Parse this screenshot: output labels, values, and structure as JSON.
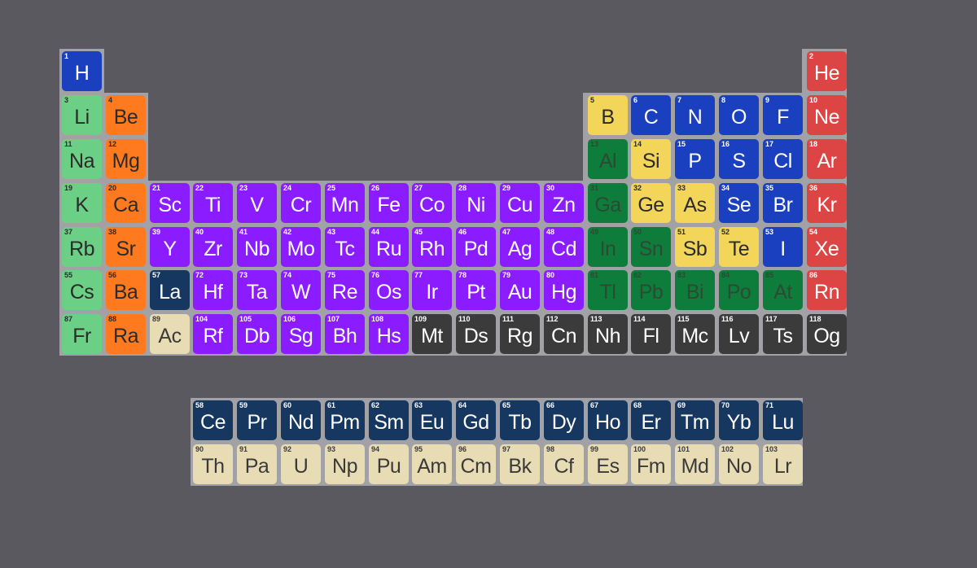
{
  "colors": {
    "background": "#5a595f",
    "panel": "#a2a2a6",
    "categories": {
      "nonmetal": {
        "bg": "#1a3fbf",
        "fg": "#ffffff"
      },
      "noble": {
        "bg": "#dd4444",
        "fg": "#ffffff"
      },
      "alkali": {
        "bg": "#6ccf86",
        "fg": "#2b2b2b"
      },
      "alkaline": {
        "bg": "#ff7a1f",
        "fg": "#2b2b2b"
      },
      "metalloid": {
        "bg": "#f3d55a",
        "fg": "#2b2b2b"
      },
      "posttransition": {
        "bg": "#0e7c3a",
        "fg": "#2c4a34"
      },
      "transition": {
        "bg": "#8a1cff",
        "fg": "#ffffff"
      },
      "lanthanide": {
        "bg": "#16375f",
        "fg": "#ffffff"
      },
      "actinide": {
        "bg": "#e8dcb5",
        "fg": "#3a3a3a"
      },
      "unknown": {
        "bg": "#3b3b3b",
        "fg": "#ffffff"
      }
    }
  },
  "elements": [
    {
      "num": "1",
      "sym": "H",
      "cat": "nonmetal",
      "row": 1,
      "col": 1
    },
    {
      "num": "2",
      "sym": "He",
      "cat": "noble",
      "row": 1,
      "col": 18
    },
    {
      "num": "3",
      "sym": "Li",
      "cat": "alkali",
      "row": 2,
      "col": 1
    },
    {
      "num": "4",
      "sym": "Be",
      "cat": "alkaline",
      "row": 2,
      "col": 2
    },
    {
      "num": "5",
      "sym": "B",
      "cat": "metalloid",
      "row": 2,
      "col": 13
    },
    {
      "num": "6",
      "sym": "C",
      "cat": "nonmetal",
      "row": 2,
      "col": 14
    },
    {
      "num": "7",
      "sym": "N",
      "cat": "nonmetal",
      "row": 2,
      "col": 15
    },
    {
      "num": "8",
      "sym": "O",
      "cat": "nonmetal",
      "row": 2,
      "col": 16
    },
    {
      "num": "9",
      "sym": "F",
      "cat": "nonmetal",
      "row": 2,
      "col": 17
    },
    {
      "num": "10",
      "sym": "Ne",
      "cat": "noble",
      "row": 2,
      "col": 18
    },
    {
      "num": "11",
      "sym": "Na",
      "cat": "alkali",
      "row": 3,
      "col": 1
    },
    {
      "num": "12",
      "sym": "Mg",
      "cat": "alkaline",
      "row": 3,
      "col": 2
    },
    {
      "num": "13",
      "sym": "Al",
      "cat": "posttransition",
      "row": 3,
      "col": 13
    },
    {
      "num": "14",
      "sym": "Si",
      "cat": "metalloid",
      "row": 3,
      "col": 14
    },
    {
      "num": "15",
      "sym": "P",
      "cat": "nonmetal",
      "row": 3,
      "col": 15
    },
    {
      "num": "16",
      "sym": "S",
      "cat": "nonmetal",
      "row": 3,
      "col": 16
    },
    {
      "num": "17",
      "sym": "Cl",
      "cat": "nonmetal",
      "row": 3,
      "col": 17
    },
    {
      "num": "18",
      "sym": "Ar",
      "cat": "noble",
      "row": 3,
      "col": 18
    },
    {
      "num": "19",
      "sym": "K",
      "cat": "alkali",
      "row": 4,
      "col": 1
    },
    {
      "num": "20",
      "sym": "Ca",
      "cat": "alkaline",
      "row": 4,
      "col": 2
    },
    {
      "num": "21",
      "sym": "Sc",
      "cat": "transition",
      "row": 4,
      "col": 3
    },
    {
      "num": "22",
      "sym": "Ti",
      "cat": "transition",
      "row": 4,
      "col": 4
    },
    {
      "num": "23",
      "sym": "V",
      "cat": "transition",
      "row": 4,
      "col": 5
    },
    {
      "num": "24",
      "sym": "Cr",
      "cat": "transition",
      "row": 4,
      "col": 6
    },
    {
      "num": "25",
      "sym": "Mn",
      "cat": "transition",
      "row": 4,
      "col": 7
    },
    {
      "num": "26",
      "sym": "Fe",
      "cat": "transition",
      "row": 4,
      "col": 8
    },
    {
      "num": "27",
      "sym": "Co",
      "cat": "transition",
      "row": 4,
      "col": 9
    },
    {
      "num": "28",
      "sym": "Ni",
      "cat": "transition",
      "row": 4,
      "col": 10
    },
    {
      "num": "29",
      "sym": "Cu",
      "cat": "transition",
      "row": 4,
      "col": 11
    },
    {
      "num": "30",
      "sym": "Zn",
      "cat": "transition",
      "row": 4,
      "col": 12
    },
    {
      "num": "31",
      "sym": "Ga",
      "cat": "posttransition",
      "row": 4,
      "col": 13
    },
    {
      "num": "32",
      "sym": "Ge",
      "cat": "metalloid",
      "row": 4,
      "col": 14
    },
    {
      "num": "33",
      "sym": "As",
      "cat": "metalloid",
      "row": 4,
      "col": 15
    },
    {
      "num": "34",
      "sym": "Se",
      "cat": "nonmetal",
      "row": 4,
      "col": 16
    },
    {
      "num": "35",
      "sym": "Br",
      "cat": "nonmetal",
      "row": 4,
      "col": 17
    },
    {
      "num": "36",
      "sym": "Kr",
      "cat": "noble",
      "row": 4,
      "col": 18
    },
    {
      "num": "37",
      "sym": "Rb",
      "cat": "alkali",
      "row": 5,
      "col": 1
    },
    {
      "num": "38",
      "sym": "Sr",
      "cat": "alkaline",
      "row": 5,
      "col": 2
    },
    {
      "num": "39",
      "sym": "Y",
      "cat": "transition",
      "row": 5,
      "col": 3
    },
    {
      "num": "40",
      "sym": "Zr",
      "cat": "transition",
      "row": 5,
      "col": 4
    },
    {
      "num": "41",
      "sym": "Nb",
      "cat": "transition",
      "row": 5,
      "col": 5
    },
    {
      "num": "42",
      "sym": "Mo",
      "cat": "transition",
      "row": 5,
      "col": 6
    },
    {
      "num": "43",
      "sym": "Tc",
      "cat": "transition",
      "row": 5,
      "col": 7
    },
    {
      "num": "44",
      "sym": "Ru",
      "cat": "transition",
      "row": 5,
      "col": 8
    },
    {
      "num": "45",
      "sym": "Rh",
      "cat": "transition",
      "row": 5,
      "col": 9
    },
    {
      "num": "46",
      "sym": "Pd",
      "cat": "transition",
      "row": 5,
      "col": 10
    },
    {
      "num": "47",
      "sym": "Ag",
      "cat": "transition",
      "row": 5,
      "col": 11
    },
    {
      "num": "48",
      "sym": "Cd",
      "cat": "transition",
      "row": 5,
      "col": 12
    },
    {
      "num": "49",
      "sym": "In",
      "cat": "posttransition",
      "row": 5,
      "col": 13
    },
    {
      "num": "50",
      "sym": "Sn",
      "cat": "posttransition",
      "row": 5,
      "col": 14
    },
    {
      "num": "51",
      "sym": "Sb",
      "cat": "metalloid",
      "row": 5,
      "col": 15
    },
    {
      "num": "52",
      "sym": "Te",
      "cat": "metalloid",
      "row": 5,
      "col": 16
    },
    {
      "num": "53",
      "sym": "I",
      "cat": "nonmetal",
      "row": 5,
      "col": 17
    },
    {
      "num": "54",
      "sym": "Xe",
      "cat": "noble",
      "row": 5,
      "col": 18
    },
    {
      "num": "55",
      "sym": "Cs",
      "cat": "alkali",
      "row": 6,
      "col": 1
    },
    {
      "num": "56",
      "sym": "Ba",
      "cat": "alkaline",
      "row": 6,
      "col": 2
    },
    {
      "num": "57",
      "sym": "La",
      "cat": "lanthanide",
      "row": 6,
      "col": 3
    },
    {
      "num": "72",
      "sym": "Hf",
      "cat": "transition",
      "row": 6,
      "col": 4
    },
    {
      "num": "73",
      "sym": "Ta",
      "cat": "transition",
      "row": 6,
      "col": 5
    },
    {
      "num": "74",
      "sym": "W",
      "cat": "transition",
      "row": 6,
      "col": 6
    },
    {
      "num": "75",
      "sym": "Re",
      "cat": "transition",
      "row": 6,
      "col": 7
    },
    {
      "num": "76",
      "sym": "Os",
      "cat": "transition",
      "row": 6,
      "col": 8
    },
    {
      "num": "77",
      "sym": "Ir",
      "cat": "transition",
      "row": 6,
      "col": 9
    },
    {
      "num": "78",
      "sym": "Pt",
      "cat": "transition",
      "row": 6,
      "col": 10
    },
    {
      "num": "79",
      "sym": "Au",
      "cat": "transition",
      "row": 6,
      "col": 11
    },
    {
      "num": "80",
      "sym": "Hg",
      "cat": "transition",
      "row": 6,
      "col": 12
    },
    {
      "num": "81",
      "sym": "Tl",
      "cat": "posttransition",
      "row": 6,
      "col": 13
    },
    {
      "num": "82",
      "sym": "Pb",
      "cat": "posttransition",
      "row": 6,
      "col": 14
    },
    {
      "num": "83",
      "sym": "Bi",
      "cat": "posttransition",
      "row": 6,
      "col": 15
    },
    {
      "num": "84",
      "sym": "Po",
      "cat": "posttransition",
      "row": 6,
      "col": 16
    },
    {
      "num": "85",
      "sym": "At",
      "cat": "posttransition",
      "row": 6,
      "col": 17
    },
    {
      "num": "86",
      "sym": "Rn",
      "cat": "noble",
      "row": 6,
      "col": 18
    },
    {
      "num": "87",
      "sym": "Fr",
      "cat": "alkali",
      "row": 7,
      "col": 1
    },
    {
      "num": "88",
      "sym": "Ra",
      "cat": "alkaline",
      "row": 7,
      "col": 2
    },
    {
      "num": "89",
      "sym": "Ac",
      "cat": "actinide",
      "row": 7,
      "col": 3
    },
    {
      "num": "104",
      "sym": "Rf",
      "cat": "transition",
      "row": 7,
      "col": 4
    },
    {
      "num": "105",
      "sym": "Db",
      "cat": "transition",
      "row": 7,
      "col": 5
    },
    {
      "num": "106",
      "sym": "Sg",
      "cat": "transition",
      "row": 7,
      "col": 6
    },
    {
      "num": "107",
      "sym": "Bh",
      "cat": "transition",
      "row": 7,
      "col": 7
    },
    {
      "num": "108",
      "sym": "Hs",
      "cat": "transition",
      "row": 7,
      "col": 8
    },
    {
      "num": "109",
      "sym": "Mt",
      "cat": "unknown",
      "row": 7,
      "col": 9
    },
    {
      "num": "110",
      "sym": "Ds",
      "cat": "unknown",
      "row": 7,
      "col": 10
    },
    {
      "num": "111",
      "sym": "Rg",
      "cat": "unknown",
      "row": 7,
      "col": 11
    },
    {
      "num": "112",
      "sym": "Cn",
      "cat": "unknown",
      "row": 7,
      "col": 12
    },
    {
      "num": "113",
      "sym": "Nh",
      "cat": "unknown",
      "row": 7,
      "col": 13
    },
    {
      "num": "114",
      "sym": "Fl",
      "cat": "unknown",
      "row": 7,
      "col": 14
    },
    {
      "num": "115",
      "sym": "Mc",
      "cat": "unknown",
      "row": 7,
      "col": 15
    },
    {
      "num": "116",
      "sym": "Lv",
      "cat": "unknown",
      "row": 7,
      "col": 16
    },
    {
      "num": "117",
      "sym": "Ts",
      "cat": "unknown",
      "row": 7,
      "col": 17
    },
    {
      "num": "118",
      "sym": "Og",
      "cat": "unknown",
      "row": 7,
      "col": 18
    },
    {
      "num": "58",
      "sym": "Ce",
      "cat": "lanthanide",
      "row": 9,
      "col": 4
    },
    {
      "num": "59",
      "sym": "Pr",
      "cat": "lanthanide",
      "row": 9,
      "col": 5
    },
    {
      "num": "60",
      "sym": "Nd",
      "cat": "lanthanide",
      "row": 9,
      "col": 6
    },
    {
      "num": "61",
      "sym": "Pm",
      "cat": "lanthanide",
      "row": 9,
      "col": 7
    },
    {
      "num": "62",
      "sym": "Sm",
      "cat": "lanthanide",
      "row": 9,
      "col": 8
    },
    {
      "num": "63",
      "sym": "Eu",
      "cat": "lanthanide",
      "row": 9,
      "col": 9
    },
    {
      "num": "64",
      "sym": "Gd",
      "cat": "lanthanide",
      "row": 9,
      "col": 10
    },
    {
      "num": "65",
      "sym": "Tb",
      "cat": "lanthanide",
      "row": 9,
      "col": 11
    },
    {
      "num": "66",
      "sym": "Dy",
      "cat": "lanthanide",
      "row": 9,
      "col": 12
    },
    {
      "num": "67",
      "sym": "Ho",
      "cat": "lanthanide",
      "row": 9,
      "col": 13
    },
    {
      "num": "68",
      "sym": "Er",
      "cat": "lanthanide",
      "row": 9,
      "col": 14
    },
    {
      "num": "69",
      "sym": "Tm",
      "cat": "lanthanide",
      "row": 9,
      "col": 15
    },
    {
      "num": "70",
      "sym": "Yb",
      "cat": "lanthanide",
      "row": 9,
      "col": 16
    },
    {
      "num": "71",
      "sym": "Lu",
      "cat": "lanthanide",
      "row": 9,
      "col": 17
    },
    {
      "num": "90",
      "sym": "Th",
      "cat": "actinide",
      "row": 10,
      "col": 4
    },
    {
      "num": "91",
      "sym": "Pa",
      "cat": "actinide",
      "row": 10,
      "col": 5
    },
    {
      "num": "92",
      "sym": "U",
      "cat": "actinide",
      "row": 10,
      "col": 6
    },
    {
      "num": "93",
      "sym": "Np",
      "cat": "actinide",
      "row": 10,
      "col": 7
    },
    {
      "num": "94",
      "sym": "Pu",
      "cat": "actinide",
      "row": 10,
      "col": 8
    },
    {
      "num": "95",
      "sym": "Am",
      "cat": "actinide",
      "row": 10,
      "col": 9
    },
    {
      "num": "96",
      "sym": "Cm",
      "cat": "actinide",
      "row": 10,
      "col": 10
    },
    {
      "num": "97",
      "sym": "Bk",
      "cat": "actinide",
      "row": 10,
      "col": 11
    },
    {
      "num": "98",
      "sym": "Cf",
      "cat": "actinide",
      "row": 10,
      "col": 12
    },
    {
      "num": "99",
      "sym": "Es",
      "cat": "actinide",
      "row": 10,
      "col": 13
    },
    {
      "num": "100",
      "sym": "Fm",
      "cat": "actinide",
      "row": 10,
      "col": 14
    },
    {
      "num": "101",
      "sym": "Md",
      "cat": "actinide",
      "row": 10,
      "col": 15
    },
    {
      "num": "102",
      "sym": "No",
      "cat": "actinide",
      "row": 10,
      "col": 16
    },
    {
      "num": "103",
      "sym": "Lr",
      "cat": "actinide",
      "row": 10,
      "col": 17
    }
  ]
}
